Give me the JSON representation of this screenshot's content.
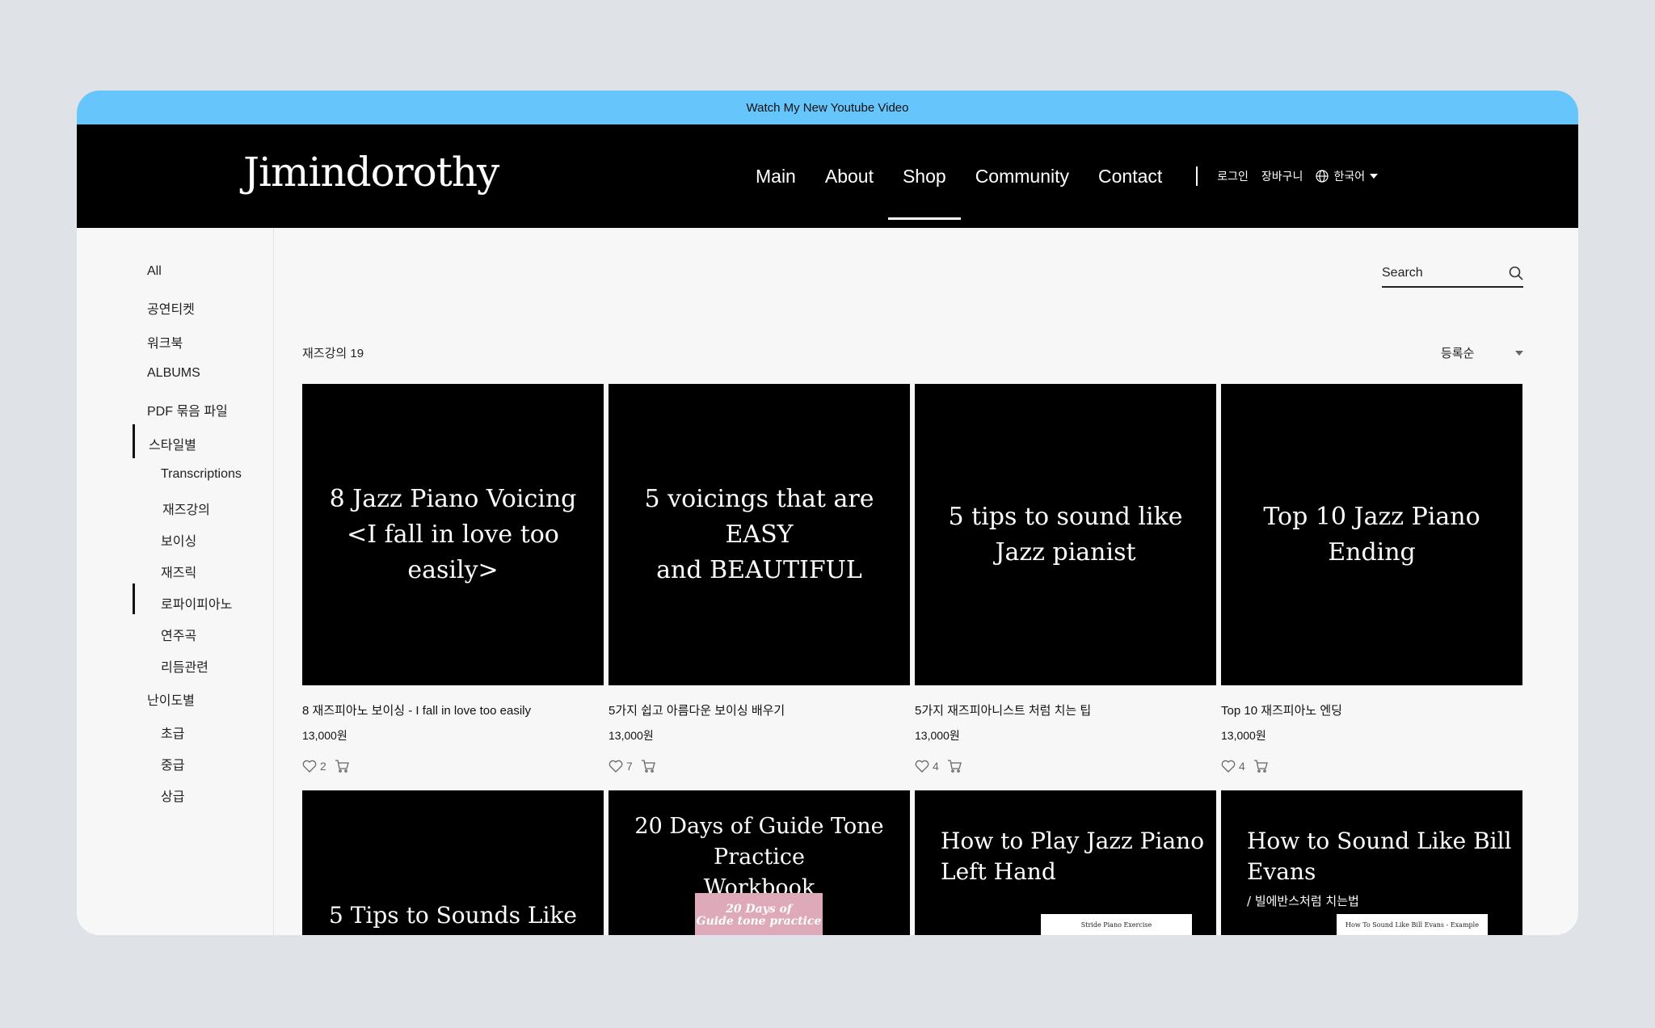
{
  "promo": {
    "text": "Watch My New Youtube Video"
  },
  "header": {
    "logo": "Jimindorothy",
    "nav": [
      "Main",
      "About",
      "Shop",
      "Community",
      "Contact"
    ],
    "active_nav": "Shop",
    "login": "로그인",
    "cart": "장바구니",
    "language": "한국어"
  },
  "sidebar": {
    "items": [
      {
        "label": "All"
      },
      {
        "label": "공연티켓"
      },
      {
        "label": "워크북"
      },
      {
        "label": "ALBUMS"
      },
      {
        "label": "PDF 묶음 파일"
      },
      {
        "label": "스타일별"
      },
      {
        "label": "Transcriptions"
      },
      {
        "label": "재즈강의"
      },
      {
        "label": "보이싱"
      },
      {
        "label": "재즈릭"
      },
      {
        "label": "로파이피아노"
      },
      {
        "label": "연주곡"
      },
      {
        "label": "리듬관련"
      },
      {
        "label": "난이도별"
      },
      {
        "label": "초급"
      },
      {
        "label": "중급"
      },
      {
        "label": "상급"
      }
    ]
  },
  "search": {
    "placeholder": "Search"
  },
  "listing": {
    "count_label": "재즈강의 19",
    "sort_label": "등록순"
  },
  "products": [
    {
      "thumb_text": [
        "8 Jazz Piano Voicing",
        "<I fall in love too easily>"
      ],
      "title": "8 재즈피아노 보이싱 - I fall in love too easily",
      "price": "13,000원",
      "likes": "2"
    },
    {
      "thumb_text": [
        "5 voicings that are EASY",
        "and BEAUTIFUL"
      ],
      "title": "5가지 쉽고 아름다운 보이싱 배우기",
      "price": "13,000원",
      "likes": "7"
    },
    {
      "thumb_text": [
        "5 tips to sound like",
        "Jazz pianist"
      ],
      "title": "5가지 재즈피아니스트 처럼 치는 팁",
      "price": "13,000원",
      "likes": "4"
    },
    {
      "thumb_text": [
        "Top 10 Jazz Piano Ending"
      ],
      "title": "Top 10 재즈피아노 엔딩",
      "price": "13,000원",
      "likes": "4"
    }
  ],
  "products_row2": [
    {
      "thumb_text": [
        "5 Tips to Sounds Like"
      ]
    },
    {
      "thumb_text": [
        "20 Days of Guide Tone Practice",
        "Workbook"
      ],
      "badge": [
        "20 Days of",
        "Guide tone practice"
      ]
    },
    {
      "thumb_text": [
        "How to Play Jazz Piano",
        "Left Hand"
      ],
      "sheet": "Stride Piano Exercise"
    },
    {
      "thumb_text": [
        "How to Sound Like Bill Evans"
      ],
      "subtitle": "/ 빌에반스처럼 치는법",
      "sheet": "How To Sound Like Bill Evans - Example Voicings"
    }
  ]
}
